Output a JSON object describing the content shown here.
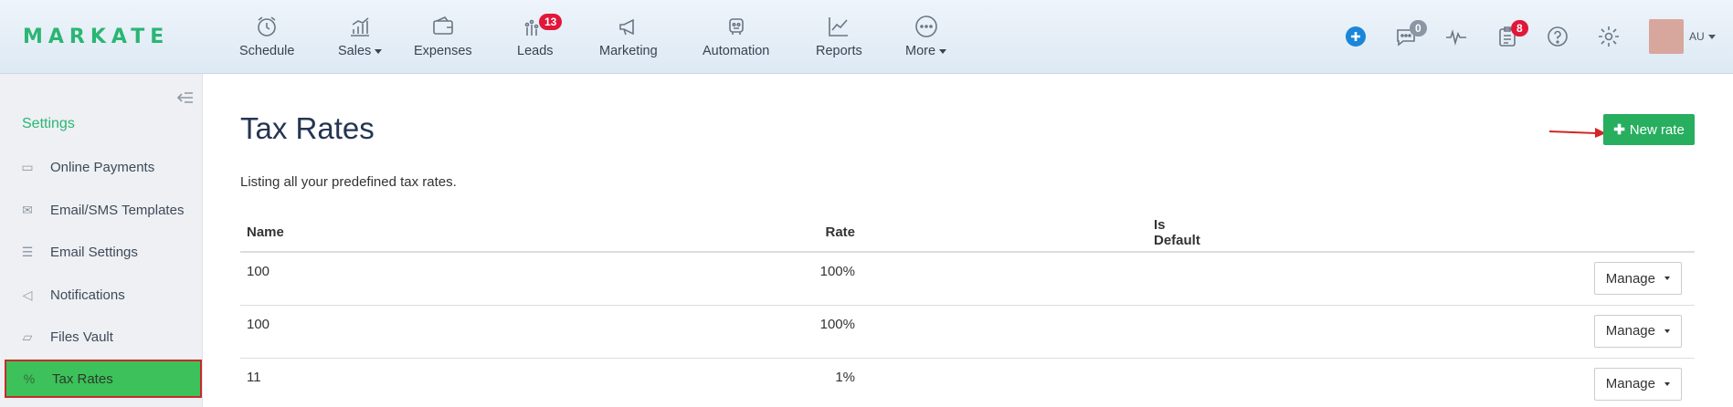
{
  "brand": "MARKATE",
  "nav": [
    {
      "label": "Schedule",
      "icon": "alarm-clock-icon"
    },
    {
      "label": "Sales",
      "icon": "bar-chart-coins-icon",
      "dropdown": true
    },
    {
      "label": "Expenses",
      "icon": "wallet-icon"
    },
    {
      "label": "Leads",
      "icon": "leads-bars-icon",
      "badge": "13"
    },
    {
      "label": "Marketing",
      "icon": "megaphone-icon"
    },
    {
      "label": "Automation",
      "icon": "robot-icon"
    },
    {
      "label": "Reports",
      "icon": "line-chart-icon"
    },
    {
      "label": "More",
      "icon": "more-dots-icon",
      "dropdown": true
    }
  ],
  "header_right": {
    "chat_badge": "0",
    "tasks_badge": "8",
    "user_initials": "AU"
  },
  "sidebar": {
    "title": "Settings",
    "items": [
      {
        "label": "Online Payments",
        "icon": "credit-card-icon"
      },
      {
        "label": "Email/SMS Templates",
        "icon": "envelope-icon"
      },
      {
        "label": "Email Settings",
        "icon": "sliders-icon"
      },
      {
        "label": "Notifications",
        "icon": "bullhorn-icon"
      },
      {
        "label": "Files Vault",
        "icon": "folder-icon"
      },
      {
        "label": "Tax Rates",
        "icon": "percent-icon",
        "active": true
      }
    ]
  },
  "main": {
    "title": "Tax Rates",
    "subtitle": "Listing all your predefined tax rates.",
    "new_button": "New rate",
    "columns": [
      "Name",
      "Rate",
      "Is Default"
    ],
    "rows": [
      {
        "name": "100",
        "rate": "100%",
        "is_default": ""
      },
      {
        "name": "100",
        "rate": "100%",
        "is_default": ""
      },
      {
        "name": "11",
        "rate": "1%",
        "is_default": ""
      }
    ],
    "manage_label": "Manage"
  },
  "colors": {
    "brand_green": "#2ab673",
    "button_green": "#27ae5f",
    "active_item": "#3dc15a",
    "badge_red": "#e0173a",
    "title_navy": "#253552"
  }
}
